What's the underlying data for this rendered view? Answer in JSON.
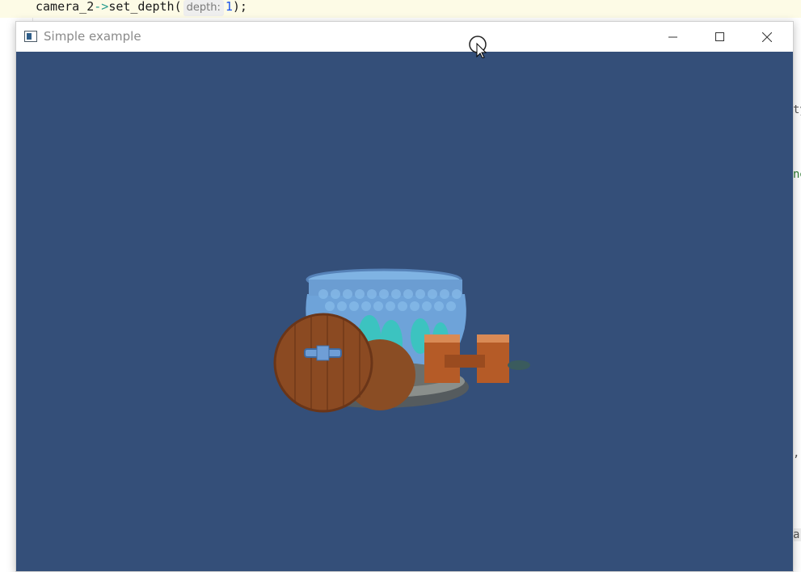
{
  "editor": {
    "code_prefix": "camera_2",
    "code_arrow": "->",
    "code_call": "set_depth(",
    "param_hint": "depth:",
    "param_value": "1",
    "code_suffix": ");",
    "right_fragments": [
      "ty",
      "ne",
      ",",
      "ar"
    ]
  },
  "window": {
    "title": "Simple example",
    "icons": {
      "app": "app-window-icon",
      "minimize": "minimize-icon",
      "maximize": "maximize-icon",
      "close": "close-icon"
    }
  },
  "viewport": {
    "background_color": "#344f79",
    "scene_object": "3d-cauldron-model-with-wooden-wheels-and-crates"
  },
  "cursor": {
    "icon": "busy-cursor-icon"
  }
}
